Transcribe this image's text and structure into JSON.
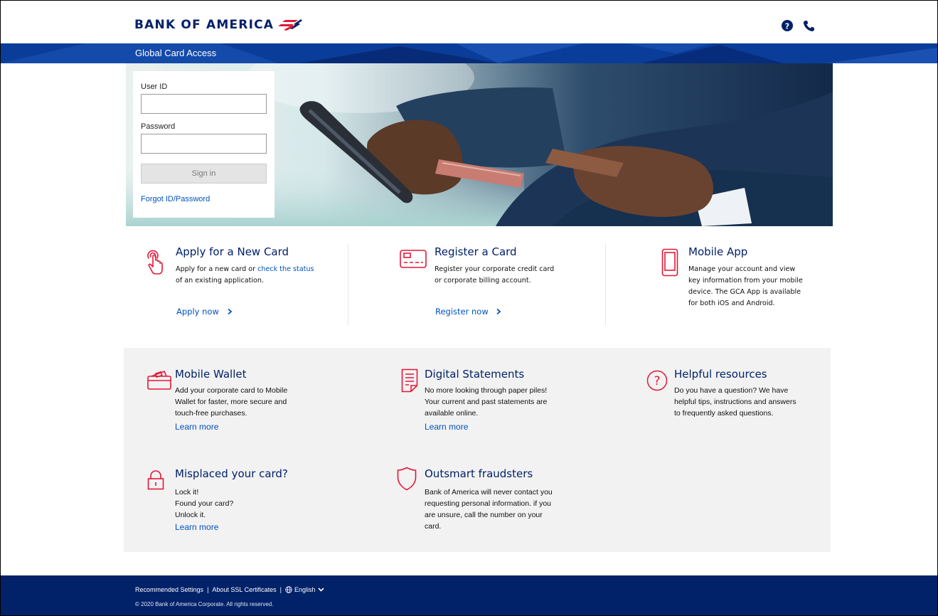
{
  "header": {
    "logo_text": "BANK OF AMERICA",
    "help_icon": "question-circle-icon",
    "phone_icon": "phone-icon"
  },
  "band": {
    "title": "Global Card Access"
  },
  "login": {
    "user_id_label": "User ID",
    "user_id_value": "",
    "password_label": "Password",
    "password_value": "",
    "sign_in_label": "Sign in",
    "forgot_label": "Forgot ID/Password"
  },
  "features": [
    {
      "icon": "hand-pointer-icon",
      "title": "Apply for a New Card",
      "text_before": "Apply for a new card or ",
      "link_text": "check the status",
      "text_after": " of an existing application.",
      "cta": "Apply now",
      "cta_icon": "chevron-right-icon"
    },
    {
      "icon": "card-icon",
      "title": "Register a Card",
      "text": "Register your corporate credit card or corporate billing account.",
      "cta": "Register now",
      "cta_icon": "chevron-right-icon"
    },
    {
      "icon": "mobile-phone-icon",
      "title": "Mobile App",
      "text": "Manage your account and view key information from your mobile device. The GCA App is available for both iOS and Android."
    }
  ],
  "tiles": [
    {
      "icon": "wallet-icon",
      "title": "Mobile Wallet",
      "text": "Add your corporate card to Mobile Wallet for faster, more secure and touch-free purchases.",
      "link": "Learn more"
    },
    {
      "icon": "document-icon",
      "title": "Digital Statements",
      "text": "No more looking through paper piles! Your current and past statements are available online.",
      "link": "Learn more"
    },
    {
      "icon": "question-icon",
      "title": "Helpful resources",
      "text": "Do you have a question?  We have helpful tips, instructions and answers to frequently asked questions."
    },
    {
      "icon": "lock-icon",
      "title": "Misplaced your card?",
      "lines": [
        "Lock it!",
        "Found your card?",
        "Unlock it."
      ],
      "link": "Learn more"
    },
    {
      "icon": "shield-icon",
      "title": "Outsmart fraudsters",
      "text": "Bank of America will never contact you requesting personal information. if you are unsure, call the number on your card."
    }
  ],
  "footer": {
    "links": [
      "Recommended Settings",
      "About SSL Certificates",
      "English"
    ],
    "separator": "|",
    "copyright": "© 2020 Bank of America Corporate. All rights reserved."
  },
  "colors": {
    "brand_navy": "#012169",
    "band_blue": "#0a3d99",
    "accent_red": "#e31837",
    "link_blue": "#0052c2"
  }
}
